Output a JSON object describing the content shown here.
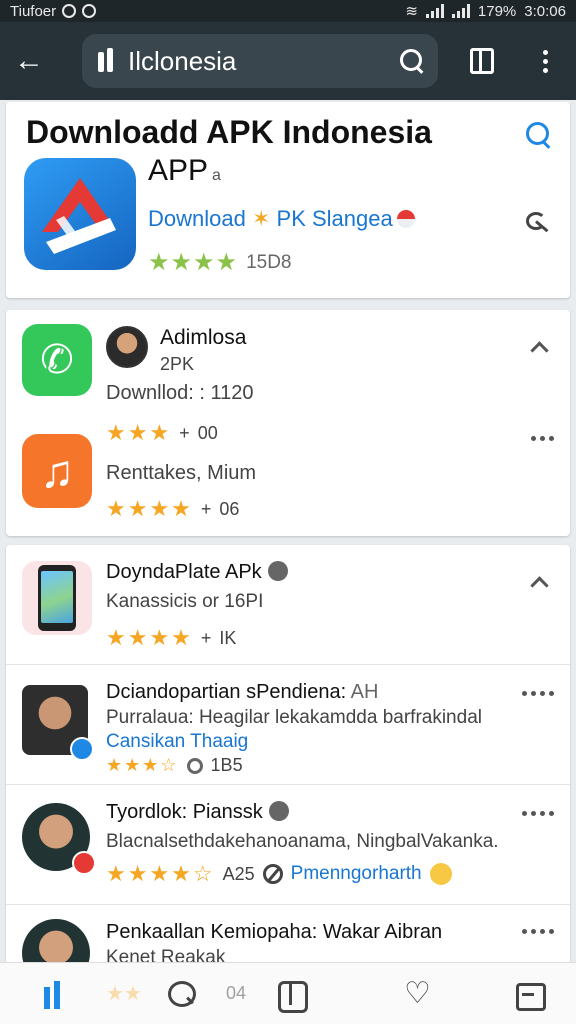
{
  "status": {
    "carrier": "Tiufoer",
    "battery": "179%",
    "time": "3:0:06"
  },
  "toolbar": {
    "query": "Ilclonesia"
  },
  "header": {
    "title": "Downloadd APK Indonesia",
    "subtitle": "APP",
    "subtitle_note": "a",
    "download_prefix": "Download",
    "download_suffix": "PK Slangea",
    "rating_text": "15D8"
  },
  "top_list": {
    "item1": {
      "name": "Adimlosa",
      "sub": "2PK",
      "downloads": "Downllod: : 1120",
      "rating_text": "00"
    },
    "item2": {
      "name": "Renttakes, Mium",
      "rating_text": "06"
    }
  },
  "feed": {
    "item1": {
      "title": "DoyndaPlate APk",
      "sub": "Kanassicis or 16PI",
      "rating_text": "IK"
    },
    "item2": {
      "title": "Dciandopartian sPendiena:",
      "tag": "AH",
      "sub": "Purralaua: Heagilar lekakamdda barfrakindal",
      "link": "Cansikan Thaaig",
      "rating_text": "1B5"
    },
    "item3": {
      "title": "Tyordlok: Pianssk",
      "sub": "Blacnalsethdakehanoanama, NingbalVakanka.",
      "rating_text": "A25",
      "link": "Pmenngorharth"
    },
    "item4": {
      "title": "Penkaallan Kemiopaha: Wakar Aibran",
      "sub": "Kenet Reakak"
    }
  },
  "bottom_nav": {
    "peek_text": "04"
  },
  "colors": {
    "toolbar": "#263238",
    "accent": "#1e88e5",
    "star": "#f5a623",
    "star_green": "#8bc34a"
  }
}
